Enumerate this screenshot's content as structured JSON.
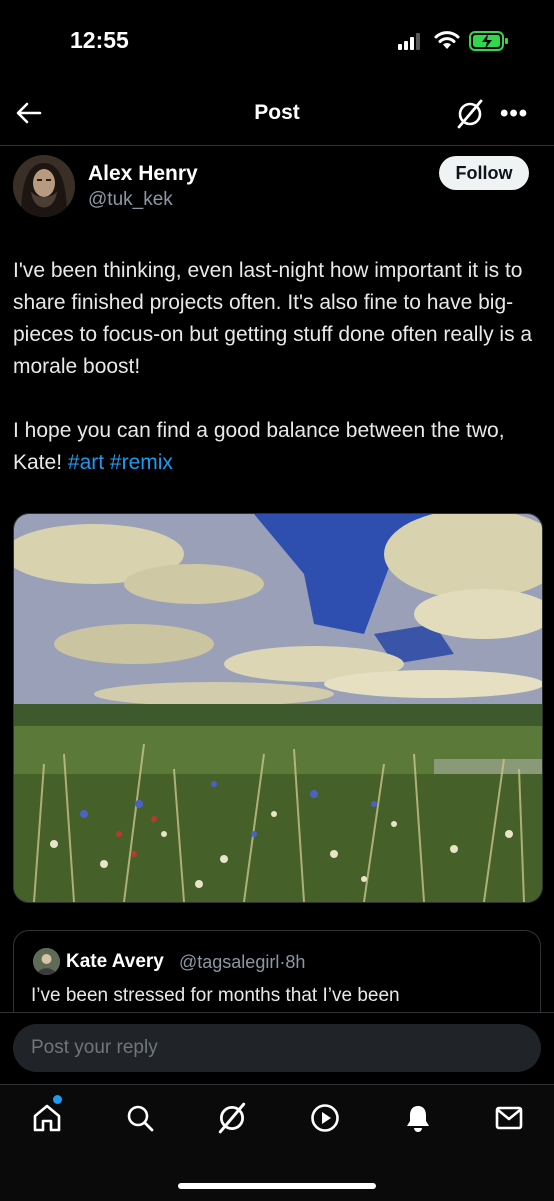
{
  "status_bar": {
    "time": "12:55"
  },
  "header": {
    "title": "Post"
  },
  "author": {
    "name": "Alex Henry",
    "handle": "@tuk_kek",
    "follow_label": "Follow"
  },
  "post": {
    "paragraph1": "I've been thinking, even last-night how important it is to share finished projects often. It's also fine to have big-pieces to focus-on but getting stuff done often really is a morale boost!",
    "paragraph2_text": "I hope you can find a good balance between the two, Kate!",
    "hashtags": [
      "#art",
      "#remix"
    ],
    "image_icon": "painted-meadow-landscape"
  },
  "quoted": {
    "name": "Kate Avery",
    "handle": "@tagsalegirl",
    "separator": "·",
    "time": "8h",
    "text": "I’ve been stressed for months that I’ve been"
  },
  "reply": {
    "placeholder": "Post your reply"
  },
  "tabs": [
    {
      "icon": "home-icon"
    },
    {
      "icon": "search-icon"
    },
    {
      "icon": "grok-icon"
    },
    {
      "icon": "video-icon"
    },
    {
      "icon": "bell-icon"
    },
    {
      "icon": "mail-icon"
    }
  ],
  "colors": {
    "accent": "#1d9bf0",
    "background": "#000000",
    "battery": "#32d74b"
  }
}
